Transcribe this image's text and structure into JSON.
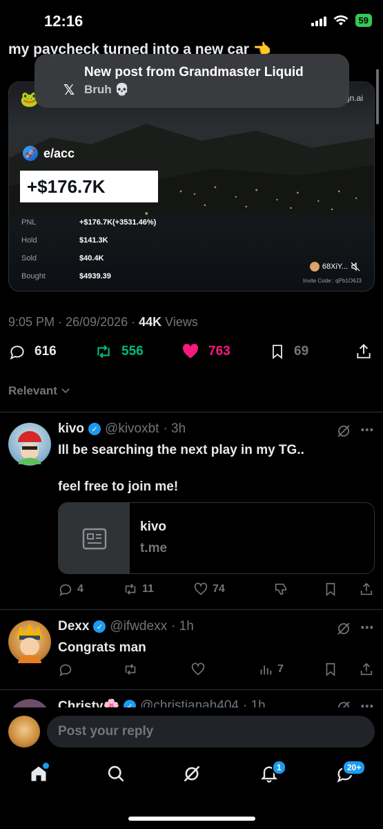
{
  "status_bar": {
    "time": "12:16",
    "battery": "59"
  },
  "post": {
    "text": "my paycheck turned into a new car 👈",
    "meta_time": "9:05 PM · 26/09/2026 · ",
    "views_count": "44K",
    "views_label": " Views",
    "stats": {
      "replies": "616",
      "reposts": "556",
      "likes": "763",
      "bookmarks": "69"
    },
    "colors": {
      "repost": "#00ba7c",
      "like": "#f91880"
    }
  },
  "media": {
    "brand": "gn.ai",
    "token": "e/acc",
    "pnl_big": "+$176.7K",
    "rows": [
      {
        "label": "PNL",
        "value": "+$176.7K(+3531.46%)"
      },
      {
        "label": "Hold",
        "value": "$141.3K"
      },
      {
        "label": "Sold",
        "value": "$40.4K"
      },
      {
        "label": "Bought",
        "value": "$4939.39"
      }
    ],
    "user": "68XiY...",
    "invite": "Invite Code : qPb1O6J3"
  },
  "notification": {
    "title": "New post from Grandmaster Liquid",
    "app_glyph": "𝕏",
    "body": "Bruh 💀"
  },
  "sort_label": "Relevant",
  "replies": [
    {
      "name": "kivo",
      "handle": "@kivoxbt",
      "time": "· 3h",
      "text_line1": "Ill be searching the next play in my TG..",
      "text_line2": "feel free to join me!",
      "card_title": "kivo",
      "card_domain": "t.me",
      "comments": "4",
      "reposts": "11",
      "likes": "74"
    },
    {
      "name": "Dexx",
      "handle": "@ifwdexx",
      "time": "· 1h",
      "text": "Congrats man",
      "views": "7"
    },
    {
      "name": "Christy🌸",
      "handle": "@christianah404",
      "time": "· 1h"
    }
  ],
  "composer": {
    "placeholder": "Post your reply"
  },
  "nav": {
    "notifications_badge": "1",
    "messages_badge": "20+"
  }
}
